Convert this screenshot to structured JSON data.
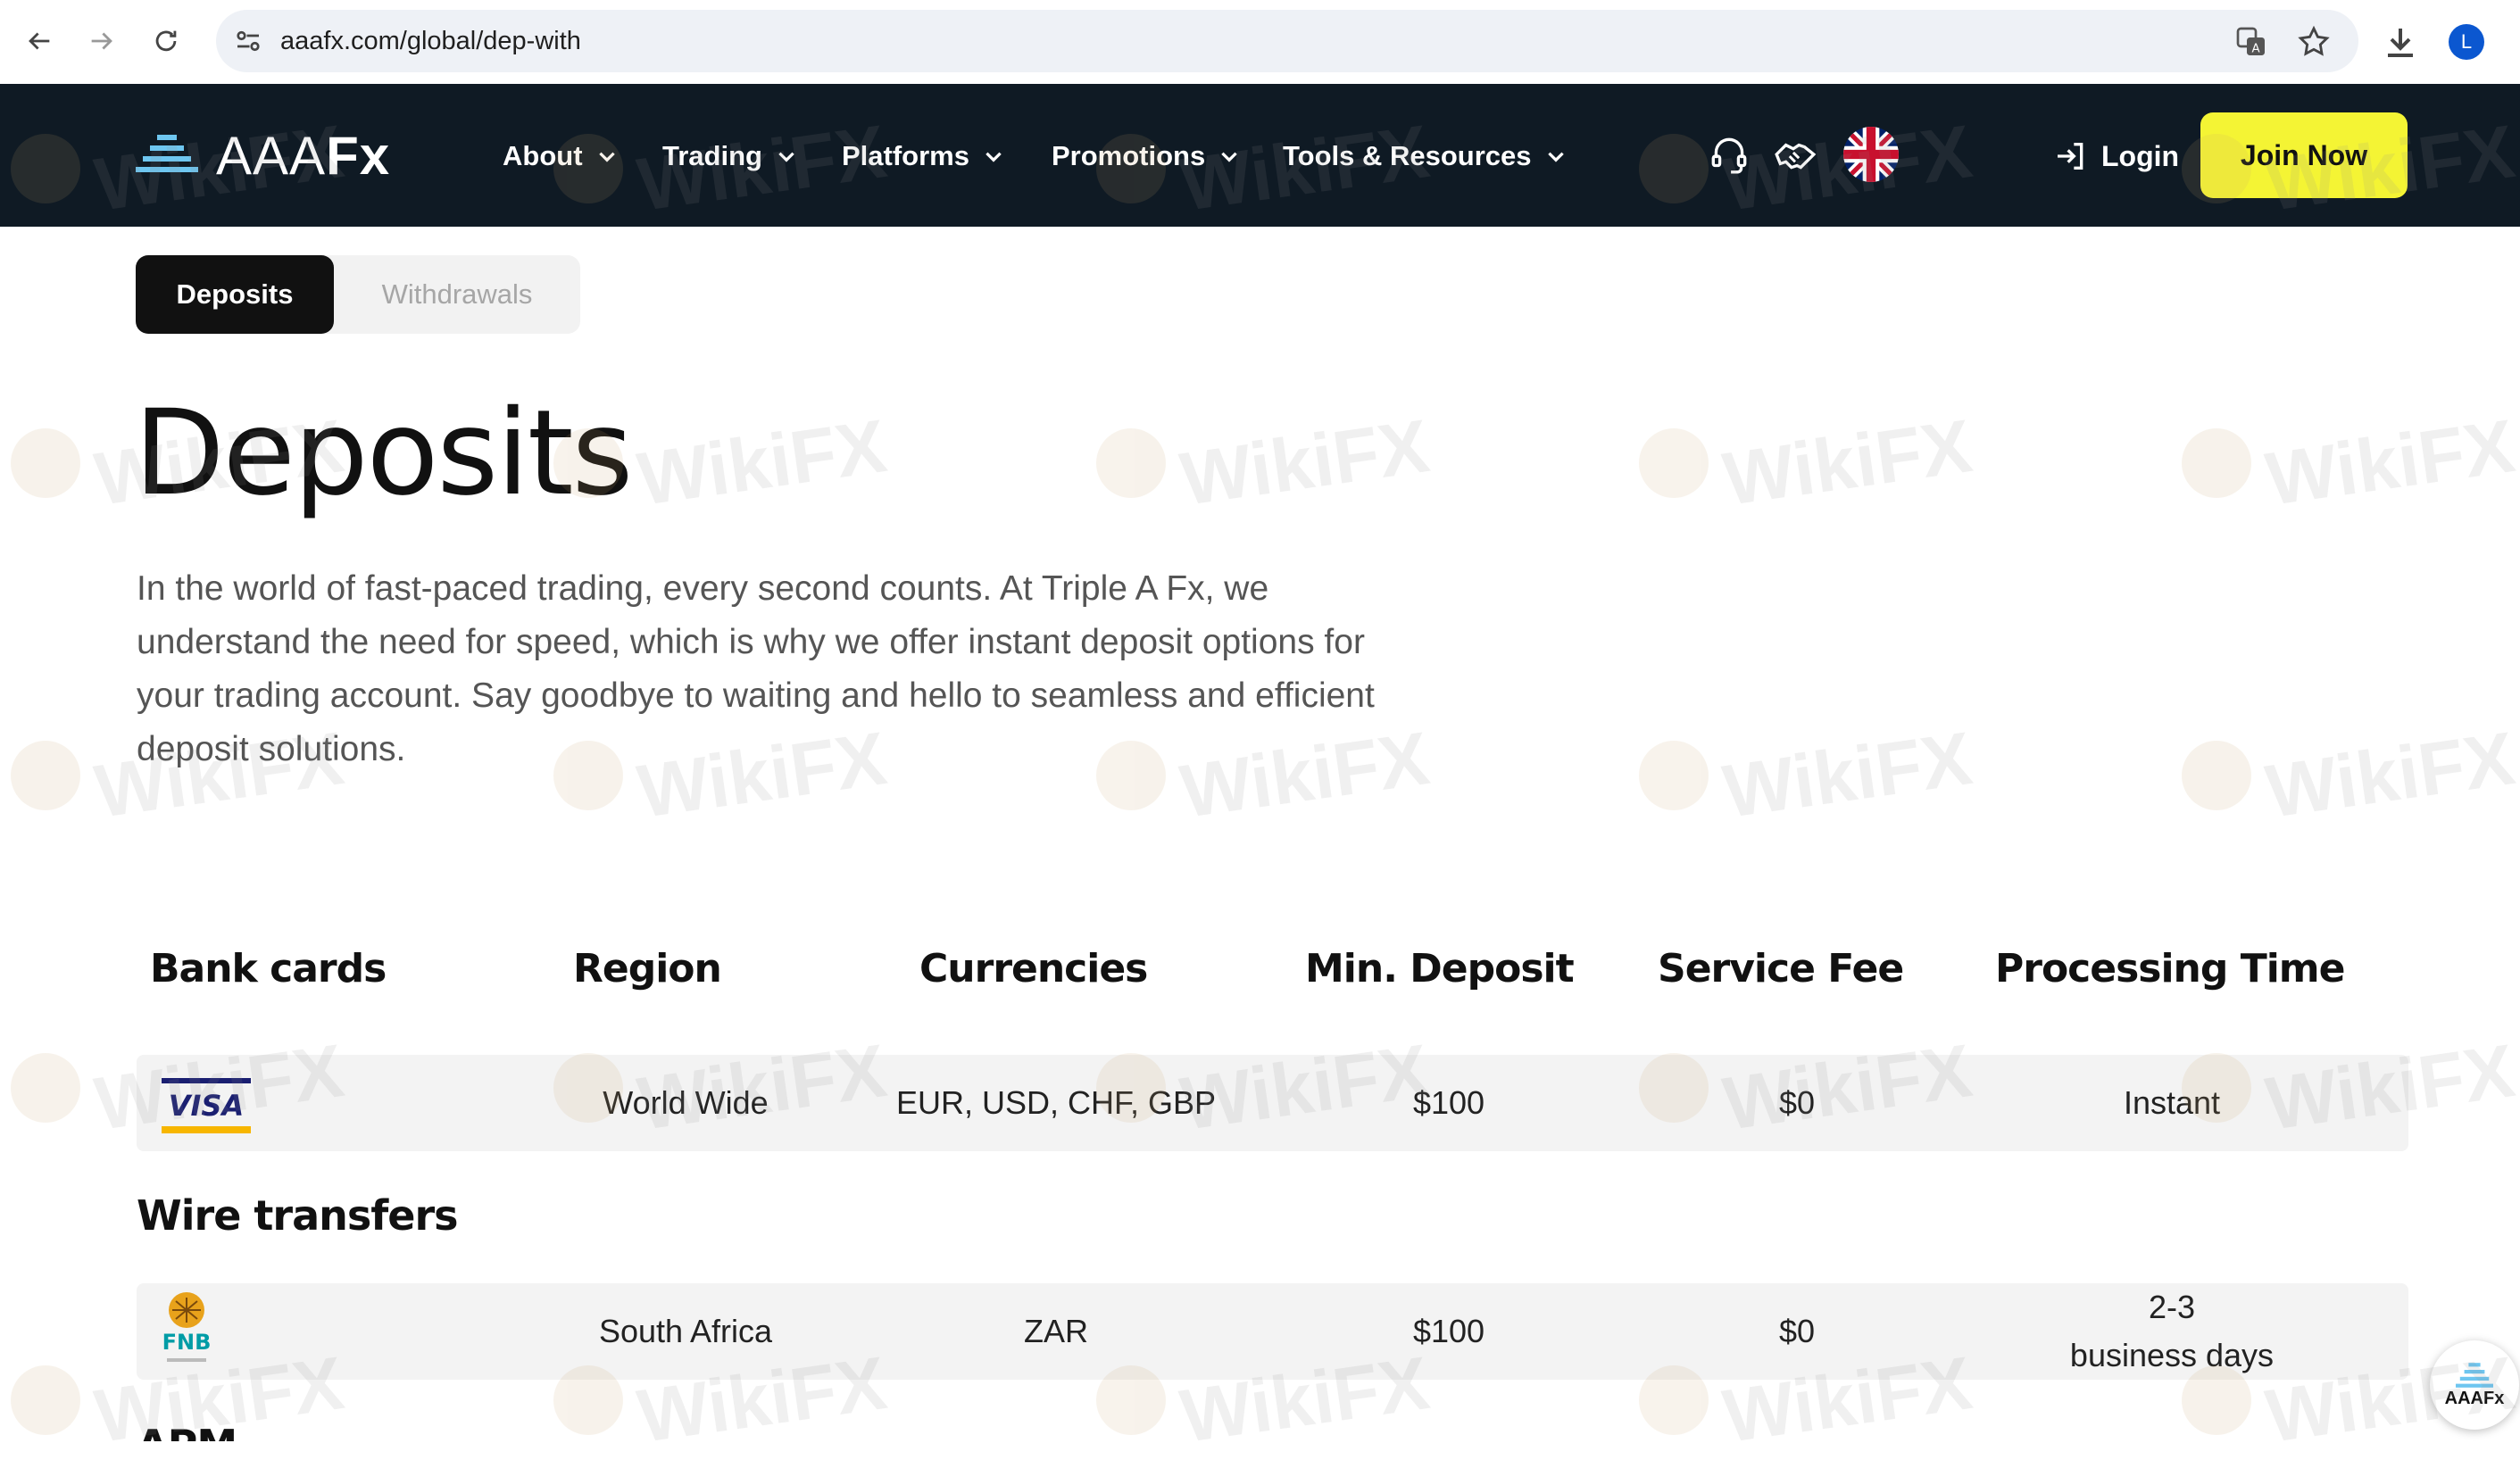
{
  "browser": {
    "url": "aaafx.com/global/dep-with",
    "profile_initial": "L"
  },
  "header": {
    "logo_text_light": "AAA",
    "logo_text_bold": "Fx",
    "menu": [
      {
        "label": "About"
      },
      {
        "label": "Trading"
      },
      {
        "label": "Platforms"
      },
      {
        "label": "Promotions"
      },
      {
        "label": "Tools & Resources"
      }
    ],
    "login_label": "Login",
    "join_label": "Join Now"
  },
  "tabs": [
    {
      "label": "Deposits",
      "active": true
    },
    {
      "label": "Withdrawals",
      "active": false
    }
  ],
  "page": {
    "title": "Deposits",
    "intro": "In the world of fast-paced trading, every second counts. At Triple A Fx, we understand the need for speed, which is why we offer instant deposit options for your trading account. Say goodbye to waiting and hello to seamless and efficient deposit solutions."
  },
  "table": {
    "headers": [
      "Bank cards",
      "Region",
      "Currencies",
      "Min. Deposit",
      "Service Fee",
      "Processing Time"
    ],
    "bank_cards": [
      {
        "method": "VISA",
        "region": "World Wide",
        "currencies": "EUR, USD, CHF, GBP",
        "min_deposit": "$100",
        "service_fee": "$0",
        "processing_time": "Instant"
      }
    ],
    "wire_section_title": "Wire transfers",
    "wire_transfers": [
      {
        "method": "FNB",
        "region": "South Africa",
        "currencies": "ZAR",
        "min_deposit": "$100",
        "service_fee": "$0",
        "processing_time_line1": "2-3",
        "processing_time_line2": "business days"
      }
    ],
    "apm_section_title": "APM"
  },
  "widget": {
    "label": "AAAFx"
  },
  "watermark": {
    "text": "WikiFX"
  },
  "colors": {
    "header_bg": "#0f1a24",
    "join_button": "#f4f434",
    "visa_blue": "#1a1f71",
    "visa_gold": "#f7b600",
    "logo_blue": "#6ec6f0"
  }
}
